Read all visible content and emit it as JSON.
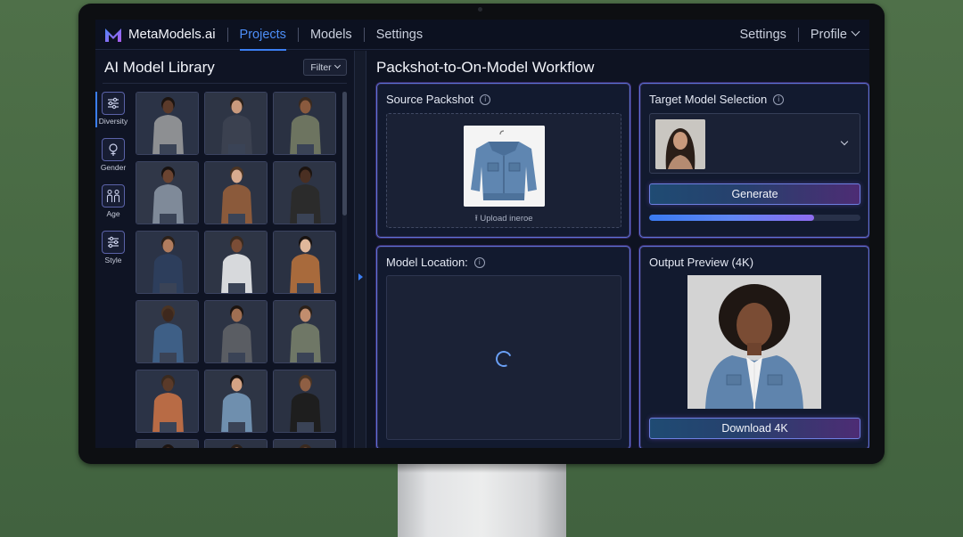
{
  "nav": {
    "brand": "MetaModels.ai",
    "links": [
      "Projects",
      "Models",
      "Settings"
    ],
    "right": {
      "settings": "Settings",
      "profile": "Profile"
    }
  },
  "library": {
    "title": "AI Model Library",
    "filter_label": "Filter",
    "tabs": [
      {
        "label": "Diversity",
        "icon": "sliders-icon"
      },
      {
        "label": "Gender",
        "icon": "gender-icon"
      },
      {
        "label": "Age",
        "icon": "people-icon"
      },
      {
        "label": "Style",
        "icon": "sliders-icon"
      }
    ]
  },
  "workflow": {
    "title": "Packshot-to-On-Model Workflow",
    "source": {
      "title": "Source Packshot",
      "upload_label": "Upload ineroe"
    },
    "target": {
      "title": "Target Model Selection",
      "generate_label": "Generate",
      "progress": 0.78
    },
    "location": {
      "title": "Model Location:"
    },
    "output": {
      "title": "Output Preview (4K)",
      "download_label": "Download 4K"
    }
  },
  "colors": {
    "accent": "#3b7ef2",
    "card_border": "#5a73d8",
    "background": "#0e1322"
  }
}
